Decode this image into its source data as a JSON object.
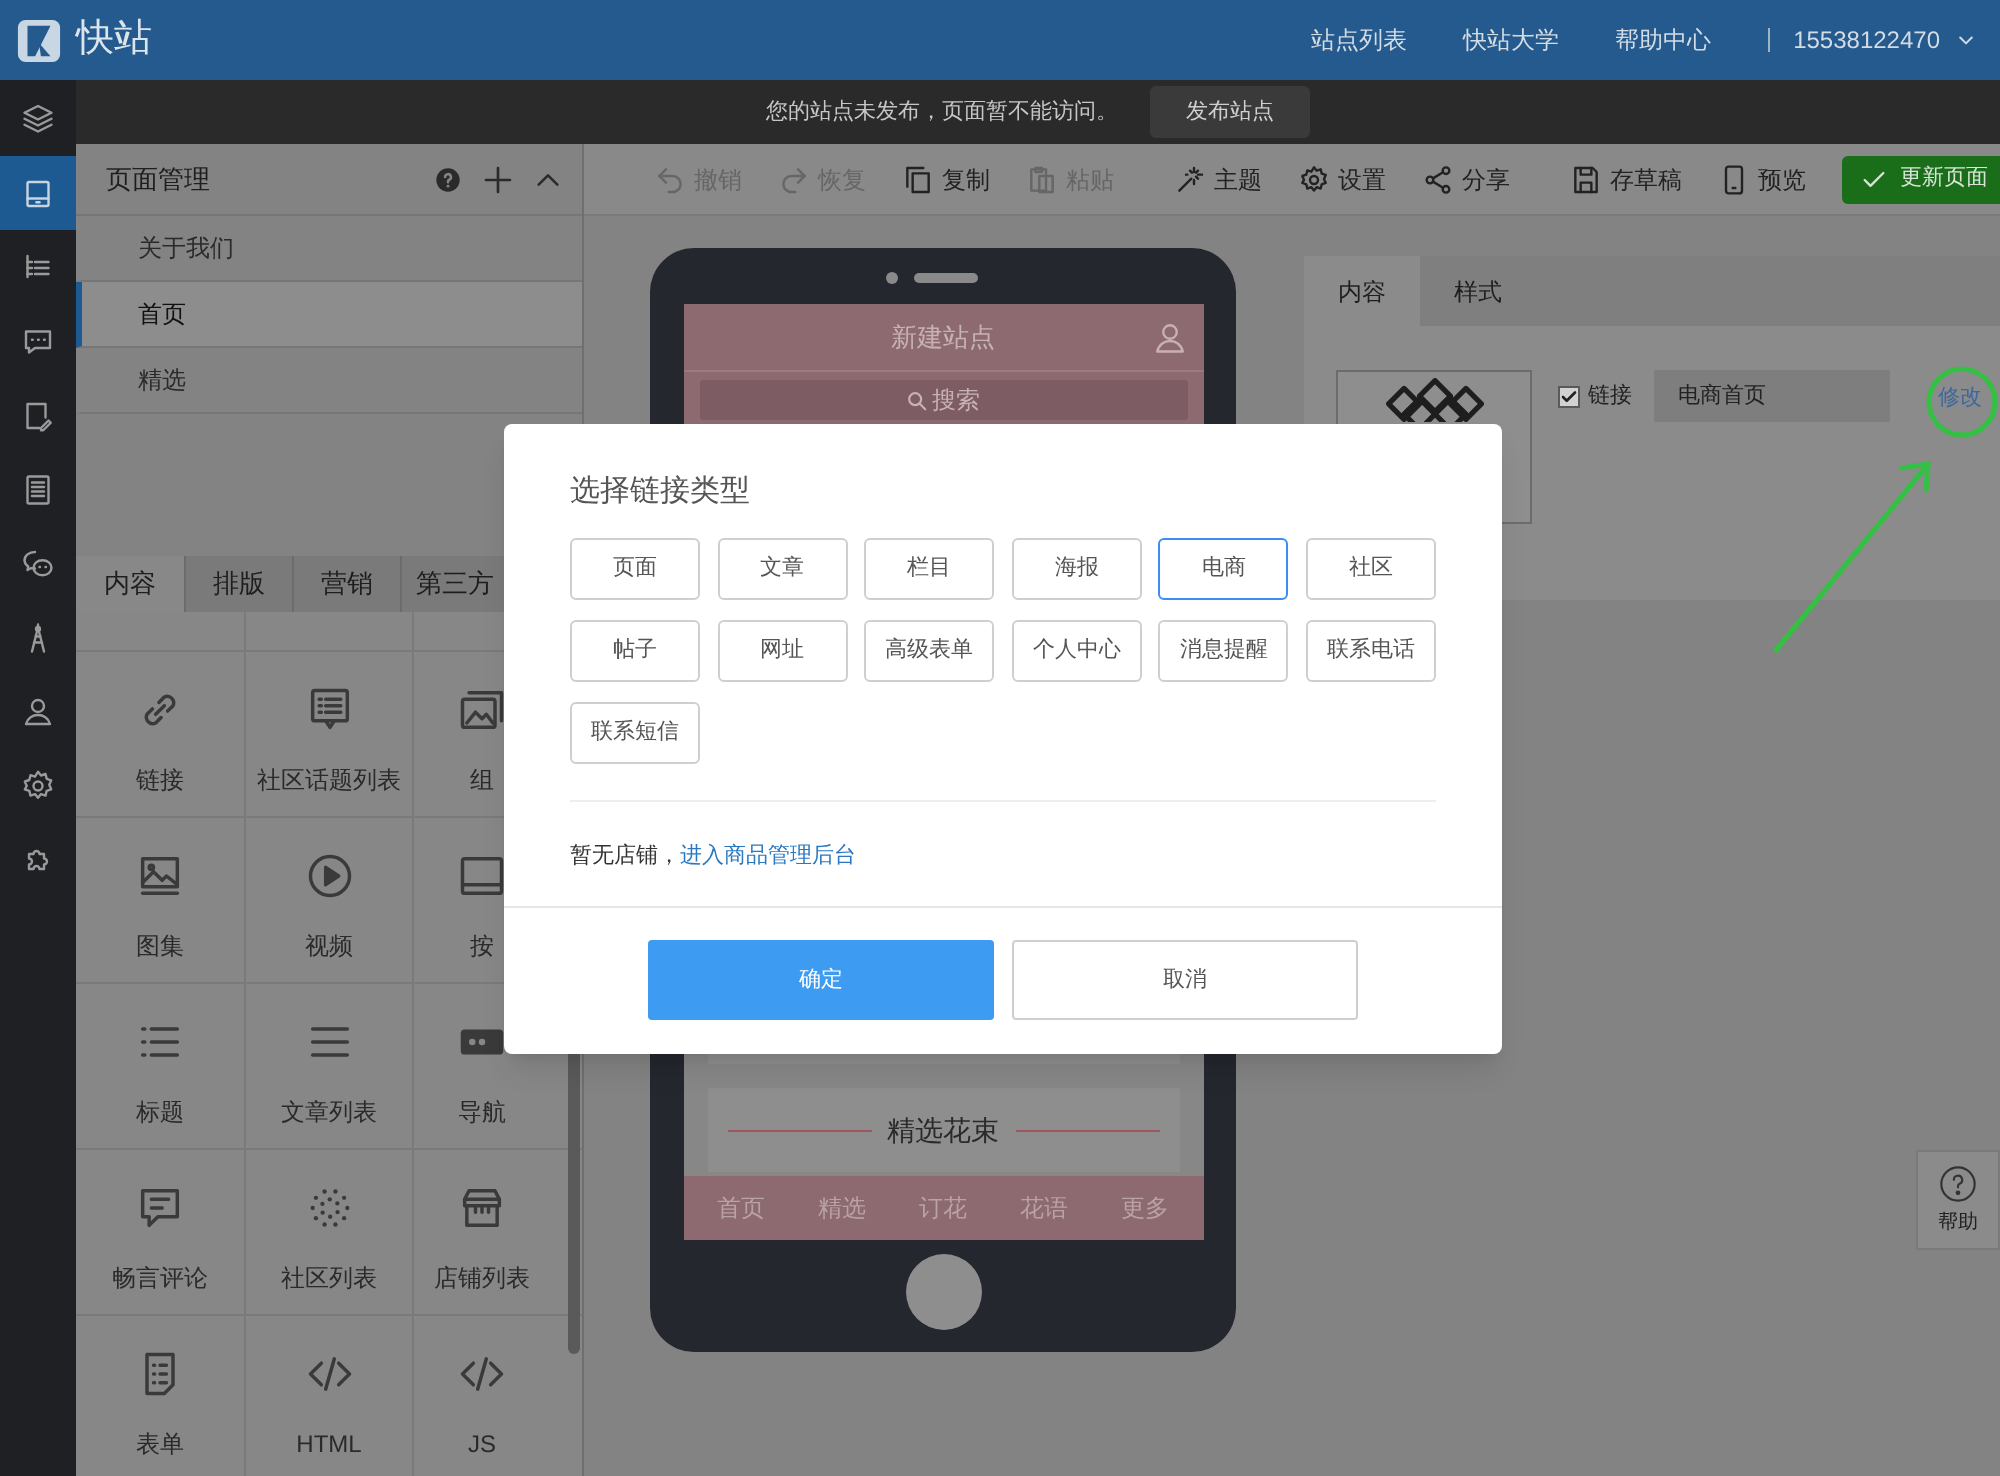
{
  "header": {
    "logo": "快站",
    "nav": [
      "站点列表",
      "快站大学",
      "帮助中心"
    ],
    "account": "15538122470"
  },
  "notice": {
    "text": "您的站点未发布，页面暂不能访问。",
    "button": "发布站点"
  },
  "rail": [
    {
      "selected": false
    },
    {
      "selected": true
    },
    {
      "selected": false
    },
    {
      "selected": false
    },
    {
      "selected": false
    },
    {
      "selected": false
    },
    {
      "selected": false
    },
    {
      "selected": false
    },
    {
      "selected": false
    },
    {
      "selected": false
    },
    {
      "selected": false
    }
  ],
  "page_manager": {
    "title": "页面管理",
    "pages": [
      {
        "label": "关于我们",
        "selected": false
      },
      {
        "label": "首页",
        "selected": true
      },
      {
        "label": "精选",
        "selected": false
      }
    ]
  },
  "widget_tabs": [
    {
      "label": "内容",
      "selected": true
    },
    {
      "label": "排版",
      "selected": false
    },
    {
      "label": "营销",
      "selected": false
    },
    {
      "label": "第三方",
      "selected": false
    }
  ],
  "widgets": [
    "链接",
    "社区话题列表",
    "组",
    "图集",
    "视频",
    "按",
    "标题",
    "文章列表",
    "导航",
    "畅言评论",
    "社区列表",
    "店铺列表",
    "表单",
    "HTML",
    "JS"
  ],
  "toolbar": {
    "groups": [
      [
        {
          "label": "撤销",
          "disabled": true
        },
        {
          "label": "恢复",
          "disabled": true
        },
        {
          "label": "复制",
          "disabled": false
        },
        {
          "label": "粘贴",
          "disabled": true
        }
      ],
      [
        {
          "label": "主题",
          "disabled": false
        },
        {
          "label": "设置",
          "disabled": false
        },
        {
          "label": "分享",
          "disabled": false
        }
      ],
      [
        {
          "label": "存草稿",
          "disabled": false
        },
        {
          "label": "预览",
          "disabled": false
        }
      ]
    ],
    "publish_button": "更新页面"
  },
  "phone": {
    "title": "新建站点",
    "search": "搜索",
    "section_title": "精选花束",
    "tabs": [
      "首页",
      "精选",
      "订花",
      "花语",
      "更多"
    ]
  },
  "properties": {
    "tabs": [
      {
        "label": "内容",
        "selected": true
      },
      {
        "label": "样式",
        "selected": false
      }
    ],
    "link": {
      "checked": true,
      "label": "链接",
      "value": "电商首页",
      "action": "修改"
    }
  },
  "help": {
    "label": "帮助"
  },
  "dialog": {
    "title": "选择链接类型",
    "types": [
      {
        "label": "页面",
        "selected": false
      },
      {
        "label": "文章",
        "selected": false
      },
      {
        "label": "栏目",
        "selected": false
      },
      {
        "label": "海报",
        "selected": false
      },
      {
        "label": "电商",
        "selected": true
      },
      {
        "label": "社区",
        "selected": false
      },
      {
        "label": "帖子",
        "selected": false
      },
      {
        "label": "网址",
        "selected": false
      },
      {
        "label": "高级表单",
        "selected": false
      },
      {
        "label": "个人中心",
        "selected": false
      },
      {
        "label": "消息提醒",
        "selected": false
      },
      {
        "label": "联系电话",
        "selected": false
      },
      {
        "label": "联系短信",
        "selected": false
      }
    ],
    "note": "暂无店铺，",
    "note_link": "进入商品管理后台",
    "confirm": "确定",
    "cancel": "取消"
  }
}
